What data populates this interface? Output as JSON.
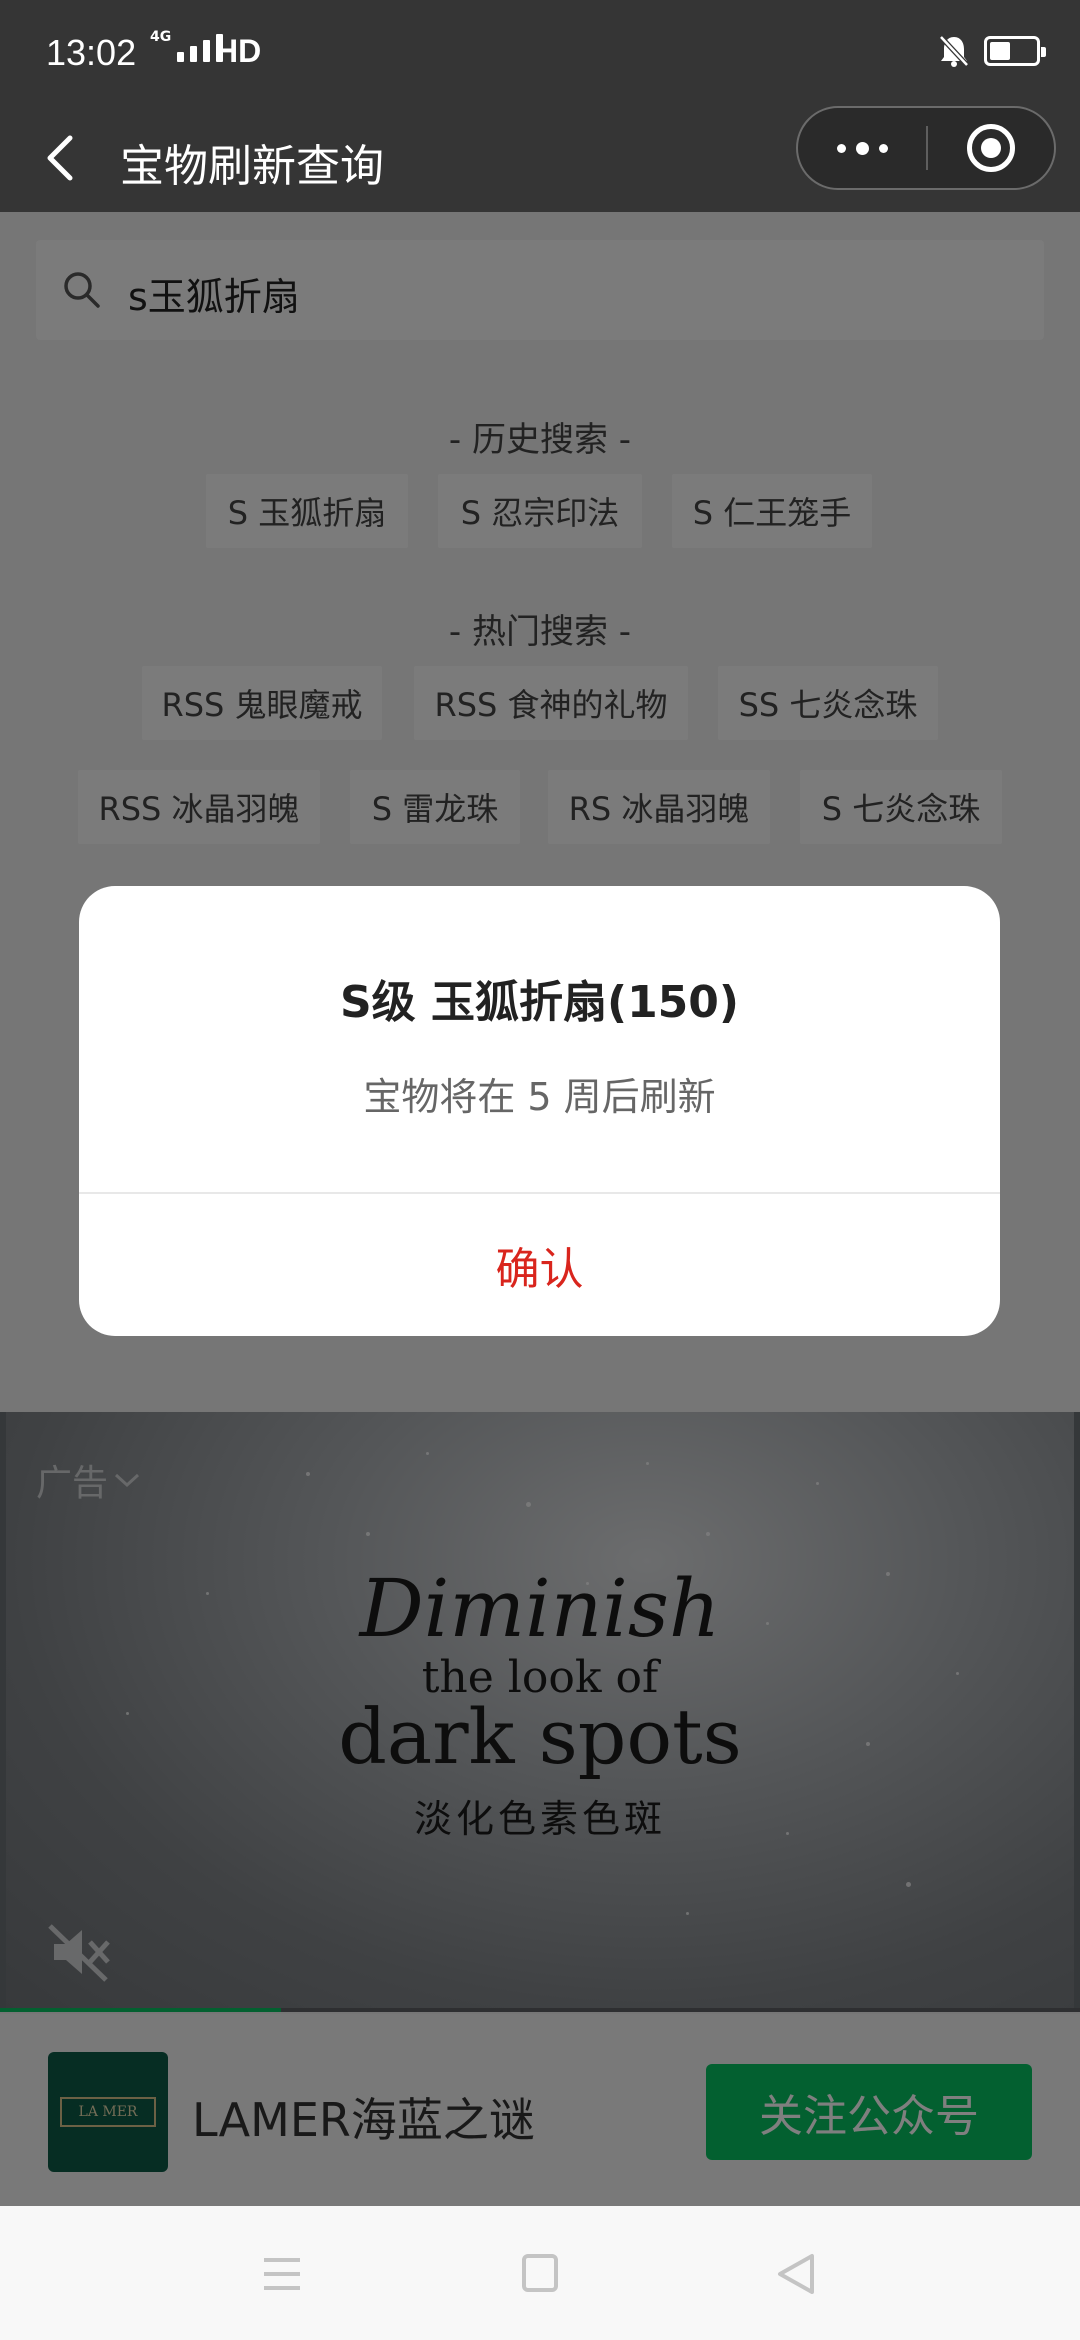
{
  "status_bar": {
    "time": "13:02",
    "network": "4G",
    "hd": "HD",
    "battery_percent": 45
  },
  "nav": {
    "title": "宝物刷新查询"
  },
  "search": {
    "value": "s玉狐折扇"
  },
  "history": {
    "title": "- 历史搜索 -",
    "chips": [
      "S 玉狐折扇",
      "S 忍宗印法",
      "S 仁王笼手"
    ]
  },
  "hot": {
    "title": "- 热门搜索 -",
    "row1": [
      "RSS 鬼眼魔戒",
      "RSS 食神的礼物",
      "SS 七炎念珠"
    ],
    "row2": [
      "RSS 冰晶羽魄",
      "S 雷龙珠",
      "RS 冰晶羽魄",
      "S 七炎念珠"
    ]
  },
  "modal": {
    "title": "S级 玉狐折扇(150)",
    "message": "宝物将在 5 周后刷新",
    "confirm": "确认"
  },
  "ad": {
    "badge": "广告",
    "line1": "Diminish",
    "line2": "the look of",
    "line3": "dark spots",
    "line4": "淡化色素色斑",
    "progress_fraction": 0.26,
    "brand_logo_text": "LA MER",
    "brand_name": "LAMER海蓝之谜",
    "follow": "关注公众号"
  },
  "colors": {
    "accent_red": "#d9251d",
    "wechat_green": "#07c160",
    "nav_bg": "#353535"
  }
}
